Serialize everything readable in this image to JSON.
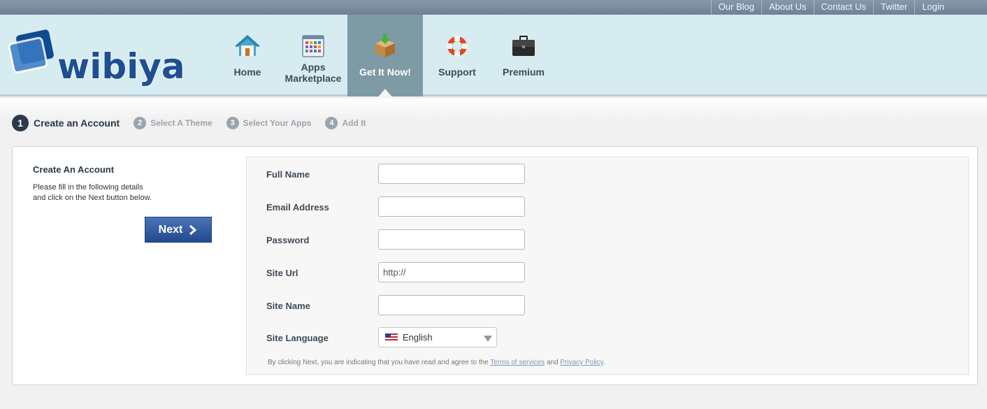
{
  "top_links": [
    "Our Blog",
    "About Us",
    "Contact Us",
    "Twitter",
    "Login"
  ],
  "logo_text": "wibiya",
  "nav": {
    "home": "Home",
    "apps_line1": "Apps",
    "apps_line2": "Marketplace",
    "get": "Get It Now!",
    "support": "Support",
    "premium": "Premium"
  },
  "steps": [
    {
      "num": "1",
      "label": "Create an Account"
    },
    {
      "num": "2",
      "label": "Select A Theme"
    },
    {
      "num": "3",
      "label": "Select Your Apps"
    },
    {
      "num": "4",
      "label": "Add It"
    }
  ],
  "side": {
    "title": "Create An Account",
    "desc_line1": "Please fill in the following details",
    "desc_line2": "and click on the Next button below.",
    "next_label": "Next"
  },
  "form": {
    "full_name_label": "Full Name",
    "full_name_value": "",
    "email_label": "Email Address",
    "email_value": "",
    "password_label": "Password",
    "password_value": "",
    "site_url_label": "Site Url",
    "site_url_value": "http://",
    "site_name_label": "Site Name",
    "site_name_value": "",
    "language_label": "Site Language",
    "language_value": "English"
  },
  "terms": {
    "prefix": "By clicking Next, you are indicating that you have read and agree to the",
    "tos": "Terms of services",
    "and": "and",
    "privacy": "Privacy Policy",
    "suffix": "."
  },
  "colors": {
    "header_bg": "#d6ecf1",
    "topbar_bg": "#7a8ca0",
    "active_nav": "#7d9aa5",
    "next_button": "#2f5598"
  }
}
